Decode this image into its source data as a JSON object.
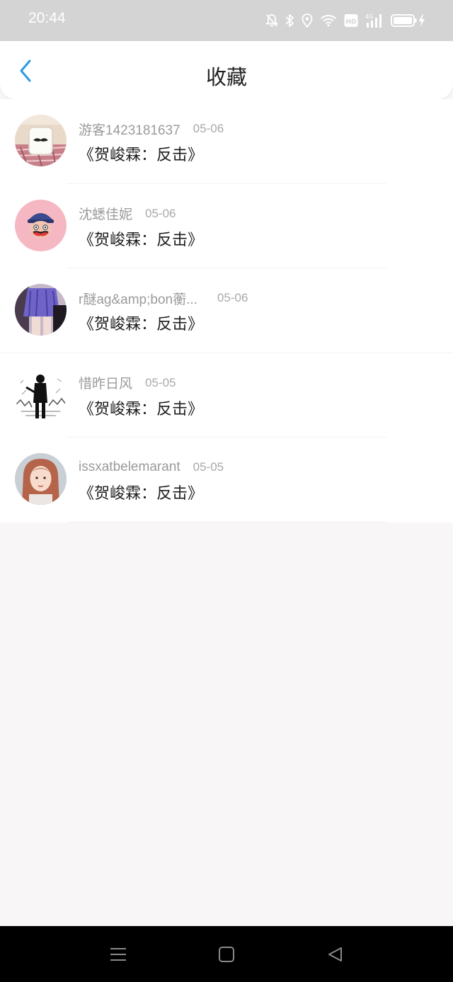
{
  "status_bar": {
    "time": "20:44",
    "icons": [
      "bell-off-icon",
      "bluetooth-icon",
      "location-icon",
      "wifi-icon",
      "hd-icon",
      "signal-4g-icon",
      "battery-charging-icon"
    ],
    "hd_label": "HD",
    "network_label": "4G"
  },
  "header": {
    "title": "收藏",
    "back_icon": "chevron-left-icon",
    "accent_color": "#2d9ae3"
  },
  "favorites": [
    {
      "username": "游客1423181637",
      "date": "05-06",
      "title": "《贺峻霖：反击》",
      "avatar": "mustache-milk-cup"
    },
    {
      "username": "沈蟋佳妮",
      "date": "05-06",
      "title": "《贺峻霖：反击》",
      "avatar": "monkey-cartoon"
    },
    {
      "username": "r醚ag&amp;bon蘅...",
      "date": "05-06",
      "title": "《贺峻霖：反击》",
      "avatar": "purple-skirt"
    },
    {
      "username": "惜昨日风",
      "date": "05-05",
      "title": "《贺峻霖：反击》",
      "avatar": "guitarist-sketch"
    },
    {
      "username": "issxatbelemarant",
      "date": "05-05",
      "title": "《贺峻霖：反击》",
      "avatar": "girl-portrait"
    }
  ],
  "nav_bar": {
    "buttons": [
      "menu-icon",
      "home-square-icon",
      "back-triangle-icon"
    ]
  }
}
